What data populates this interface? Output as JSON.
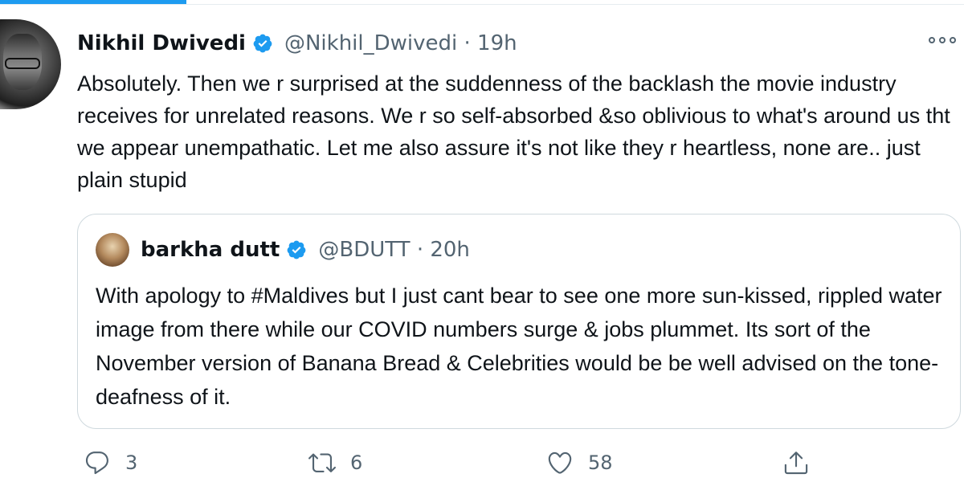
{
  "tweet": {
    "author_name": "Nikhil Dwivedi",
    "handle_time": "@Nikhil_Dwivedi · 19h",
    "text": "Absolutely. Then we r surprised at the suddenness of the backlash the movie industry receives for unrelated reasons. We r so self-absorbed &so oblivious to what's around us tht we appear unempathatic. Let me also assure it's not like they r heartless, none are.. just plain stupid"
  },
  "quoted_tweet": {
    "author_name": "barkha dutt",
    "handle_time": "@BDUTT · 20h",
    "text": "With apology to #Maldives but I just cant bear to see one more sun-kissed, rippled water image from there while our COVID numbers surge & jobs plummet. Its sort of the November version of Banana Bread & Celebrities would be be well advised on the tone-deafness of it."
  },
  "actions": {
    "reply_count": "3",
    "retweet_count": "6",
    "like_count": "58"
  },
  "colors": {
    "accent": "#1d9bf0",
    "text": "#0f1419",
    "secondary": "#536471",
    "border": "#cfd9de"
  },
  "icons": [
    "verified-badge-icon",
    "more-options-icon",
    "reply-icon",
    "retweet-icon",
    "like-icon",
    "share-icon"
  ]
}
